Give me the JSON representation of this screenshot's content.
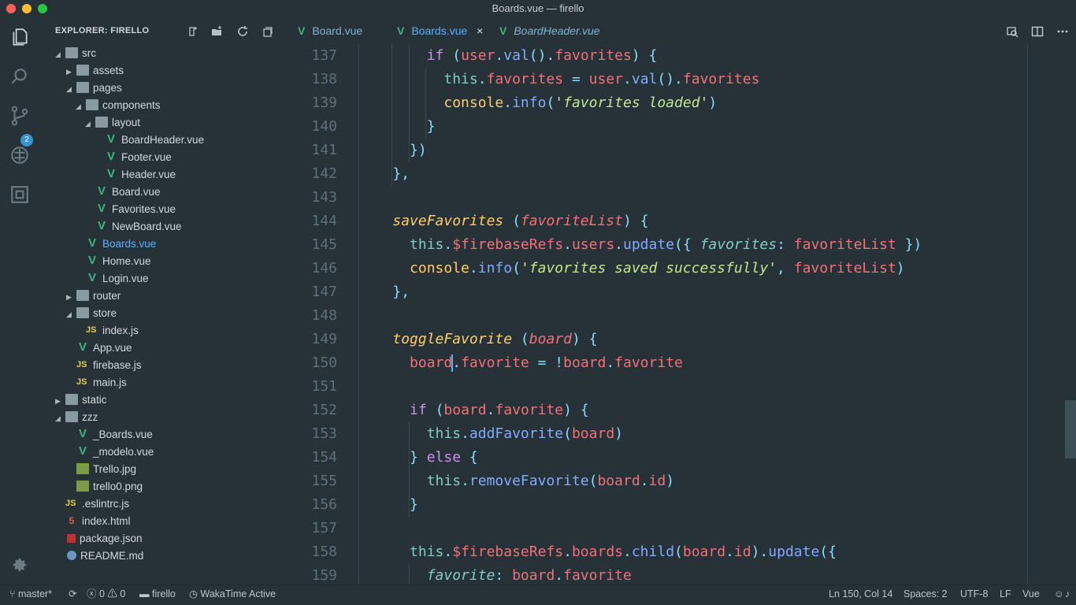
{
  "window": {
    "title": "Boards.vue — firello"
  },
  "activity_bar": {
    "items": [
      "files-icon",
      "search-icon",
      "source-control-icon",
      "debug-icon",
      "extensions-icon"
    ],
    "scm_badge": "2",
    "settings": "gear-icon"
  },
  "sidebar": {
    "title": "EXPLORER: FIRELLO",
    "actions": [
      "new-file-icon",
      "new-folder-icon",
      "refresh-icon",
      "collapse-all-icon"
    ],
    "tree": [
      {
        "label": "src",
        "type": "folder",
        "expanded": true
      },
      {
        "label": "assets",
        "type": "folder",
        "expanded": false
      },
      {
        "label": "pages",
        "type": "folder",
        "expanded": true
      },
      {
        "label": "components",
        "type": "folder",
        "expanded": true
      },
      {
        "label": "layout",
        "type": "folder",
        "expanded": true
      },
      {
        "label": "BoardHeader.vue",
        "type": "vue"
      },
      {
        "label": "Footer.vue",
        "type": "vue"
      },
      {
        "label": "Header.vue",
        "type": "vue"
      },
      {
        "label": "Board.vue",
        "type": "vue"
      },
      {
        "label": "Favorites.vue",
        "type": "vue"
      },
      {
        "label": "NewBoard.vue",
        "type": "vue"
      },
      {
        "label": "Boards.vue",
        "type": "vue",
        "active": true
      },
      {
        "label": "Home.vue",
        "type": "vue"
      },
      {
        "label": "Login.vue",
        "type": "vue"
      },
      {
        "label": "router",
        "type": "folder",
        "expanded": false
      },
      {
        "label": "store",
        "type": "folder",
        "expanded": true
      },
      {
        "label": "index.js",
        "type": "js"
      },
      {
        "label": "App.vue",
        "type": "vue"
      },
      {
        "label": "firebase.js",
        "type": "js"
      },
      {
        "label": "main.js",
        "type": "js"
      },
      {
        "label": "static",
        "type": "folder",
        "expanded": false
      },
      {
        "label": "zzz",
        "type": "folder",
        "expanded": true
      },
      {
        "label": "_Boards.vue",
        "type": "vue"
      },
      {
        "label": "_modelo.vue",
        "type": "vue"
      },
      {
        "label": "Trello.jpg",
        "type": "image"
      },
      {
        "label": "trello0.png",
        "type": "image"
      },
      {
        "label": ".eslintrc.js",
        "type": "js"
      },
      {
        "label": "index.html",
        "type": "html"
      },
      {
        "label": "package.json",
        "type": "json"
      },
      {
        "label": "README.md",
        "type": "info"
      }
    ]
  },
  "tabs": [
    {
      "label": "Board.vue",
      "active": false,
      "italic": false
    },
    {
      "label": "Boards.vue",
      "active": true,
      "italic": false,
      "close": "×"
    },
    {
      "label": "BoardHeader.vue",
      "active": false,
      "italic": true
    }
  ],
  "editor": {
    "lines": [
      137,
      138,
      139,
      140,
      141,
      142,
      143,
      144,
      145,
      146,
      147,
      148,
      149,
      150,
      151,
      152,
      153,
      154,
      155,
      156,
      157,
      158,
      159
    ],
    "cursor": "Ln 150, Col 14"
  },
  "statusbar": {
    "branch": "master*",
    "errors": "0",
    "warnings": "0",
    "folder": "firello",
    "wakatime": "WakaTime Active",
    "position": "Ln 150, Col 14",
    "spaces": "Spaces: 2",
    "encoding": "UTF-8",
    "eol": "LF",
    "language": "Vue"
  }
}
